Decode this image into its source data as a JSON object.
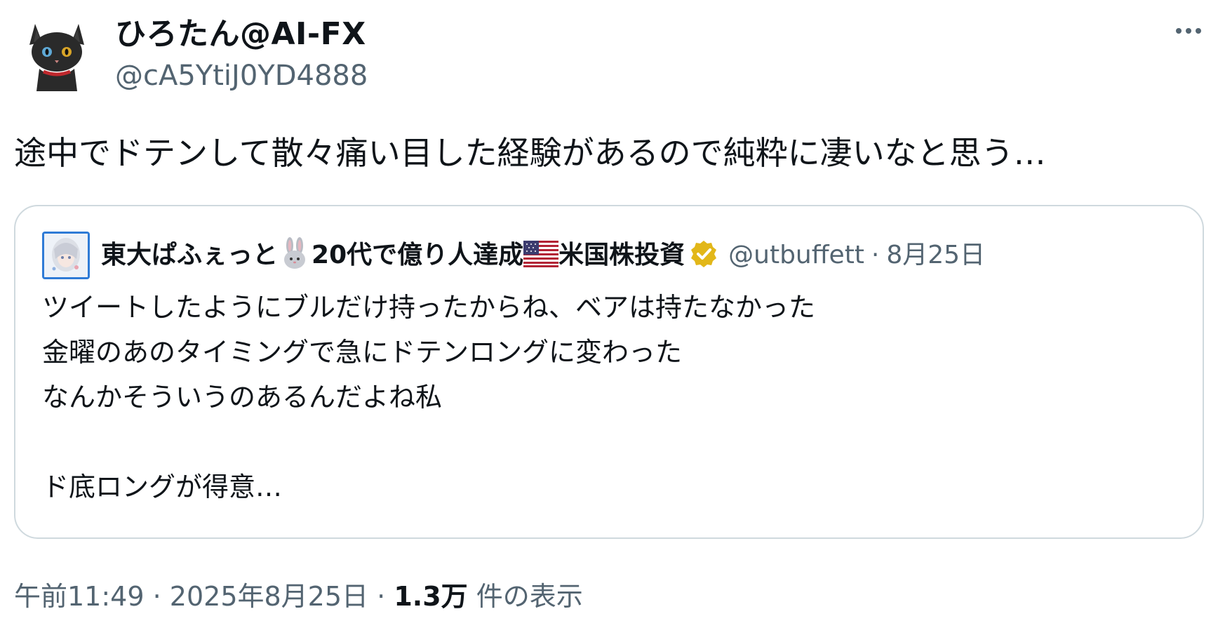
{
  "author": {
    "display_name": "ひろたん@AI-FX",
    "handle": "@cA5YtiJ0YD4888",
    "avatar_icon": "black-cat-avatar"
  },
  "tweet": {
    "text": "途中でドテンして散々痛い目した経験があるので純粋に凄いなと思う…"
  },
  "quote": {
    "name_part1": "東大ぱふぇっと",
    "name_part2": "20代で億り人達成",
    "name_part3": "米国株投資",
    "verified_icon": "gold-verified-badge",
    "handle": "@utbuffett",
    "separator": "·",
    "date": "8月25日",
    "lines": [
      "ツイートしたようにブルだけ持ったからね、ベアは持たなかった",
      "金曜のあのタイミングで急にドテンロングに変わった",
      "なんかそういうのあるんだよね私",
      "",
      "ド底ロングが得意…"
    ]
  },
  "footer": {
    "time": "午前11:49",
    "sep1": "·",
    "date": "2025年8月25日",
    "sep2": "·",
    "views_count": "1.3万",
    "views_label": "件の表示"
  },
  "colors": {
    "text": "#0f1419",
    "secondary": "#536471",
    "border": "#cfd9de",
    "verified_gold": "#e2b719",
    "quote_avatar_border": "#2f7bd6"
  }
}
